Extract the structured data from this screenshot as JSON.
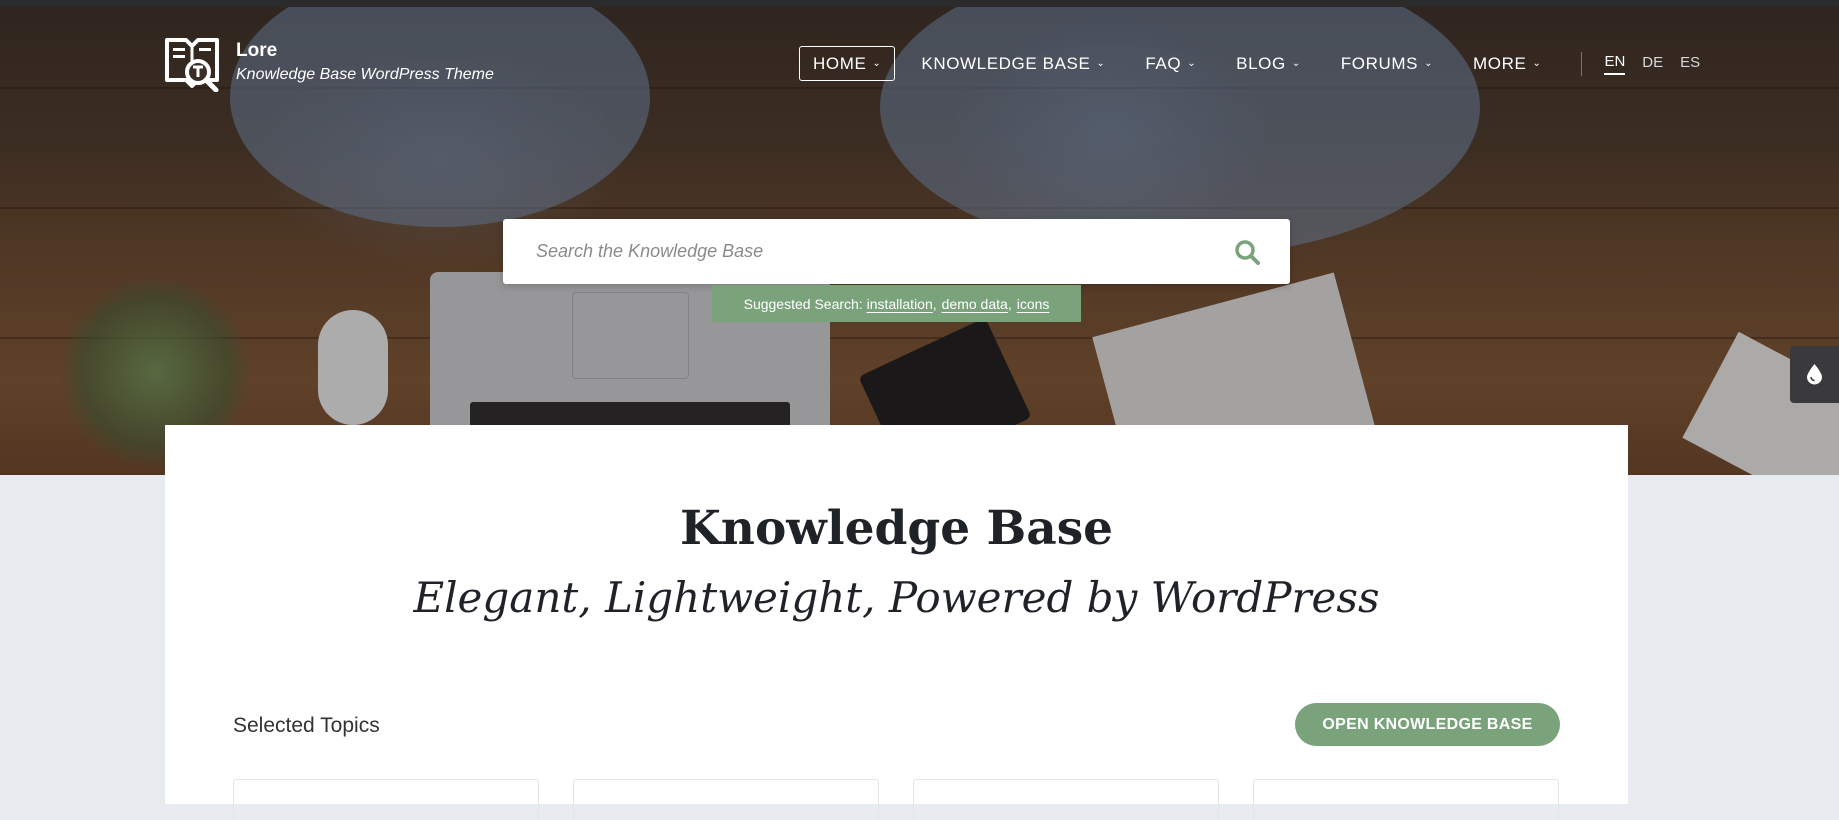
{
  "brand": {
    "name": "Lore",
    "tagline": "Knowledge Base WordPress Theme"
  },
  "nav": {
    "items": [
      {
        "label": "HOME"
      },
      {
        "label": "KNOWLEDGE BASE"
      },
      {
        "label": "FAQ"
      },
      {
        "label": "BLOG"
      },
      {
        "label": "FORUMS"
      },
      {
        "label": "MORE"
      }
    ],
    "active_item": "HOME",
    "languages": [
      "EN",
      "DE",
      "ES"
    ],
    "active_language": "EN"
  },
  "search": {
    "placeholder": "Search the Knowledge Base",
    "value": ""
  },
  "suggested": {
    "label": "Suggested Search:",
    "terms": [
      "installation",
      "demo data",
      "icons"
    ]
  },
  "main": {
    "title": "Knowledge Base",
    "subtitle": "Elegant, Lightweight, Powered by WordPress",
    "topics_label": "Selected Topics",
    "open_button": "OPEN KNOWLEDGE BASE"
  },
  "colors": {
    "accent": "#7aa37c",
    "text_dark": "#1f2328",
    "page_bg": "#e8ebf0"
  },
  "icons": {
    "logo": "logo-book-magnifier-icon",
    "search": "search-icon",
    "side_toggle": "water-drop-icon",
    "dropdown": "chevron-down-icon"
  }
}
